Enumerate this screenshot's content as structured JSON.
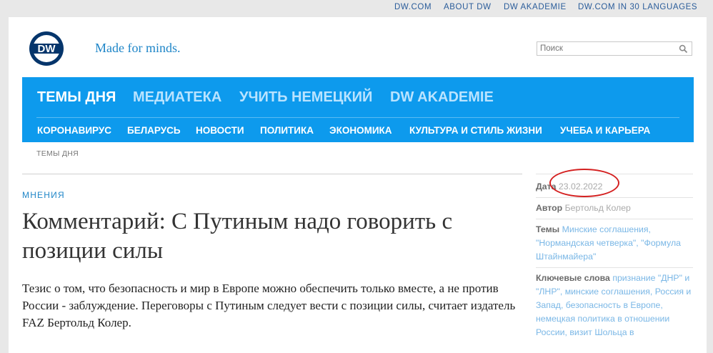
{
  "topbar": {
    "links": [
      "DW.COM",
      "ABOUT DW",
      "DW AKADEMIE",
      "DW.COM IN 30 LANGUAGES"
    ]
  },
  "brand": {
    "logo_text": "DW",
    "slogan": "Made for minds."
  },
  "search": {
    "placeholder": "Поиск"
  },
  "nav": {
    "main": [
      "ТЕМЫ ДНЯ",
      "МЕДИАТЕКА",
      "УЧИТЬ НЕМЕЦКИЙ",
      "DW AKADEMIE"
    ],
    "sub": [
      "КОРОНАВИРУС",
      "БЕЛАРУСЬ",
      "НОВОСТИ",
      "ПОЛИТИКА",
      "ЭКОНОМИКА",
      "КУЛЬТУРА И СТИЛЬ ЖИЗНИ",
      "УЧЕБА И КАРЬЕРА"
    ]
  },
  "breadcrumb": "ТЕМЫ ДНЯ",
  "article": {
    "category": "МНЕНИЯ",
    "headline": "Комментарий: С Путиным надо говорить с позиции силы",
    "lead": "Тезис о том, что безопасность и мир в Европе можно обеспечить только вместе, а не против России - заблуждение. Переговоры с Путиным следует вести с позиции силы, считает издатель FAZ Бертольд Колер."
  },
  "sidebar": {
    "date_label": "Дата",
    "date_value": "23.02.2022",
    "author_label": "Автор",
    "author_value": "Бертольд Колер",
    "topics_label": "Темы",
    "topics_value": "Минские соглашения, \"Нормандская четверка\", \"Формула Штайнмайера\"",
    "keywords_label": "Ключевые слова",
    "keywords_value": "признание \"ДНР\" и \"ЛНР\", минские соглашения, Россия и Запад, безопасность в Европе, немецкая политика в отношении России, визит Шольца в"
  },
  "colors": {
    "nav_bg": "#0d9aed",
    "link": "#1f86c8",
    "annotation": "#d42020"
  }
}
